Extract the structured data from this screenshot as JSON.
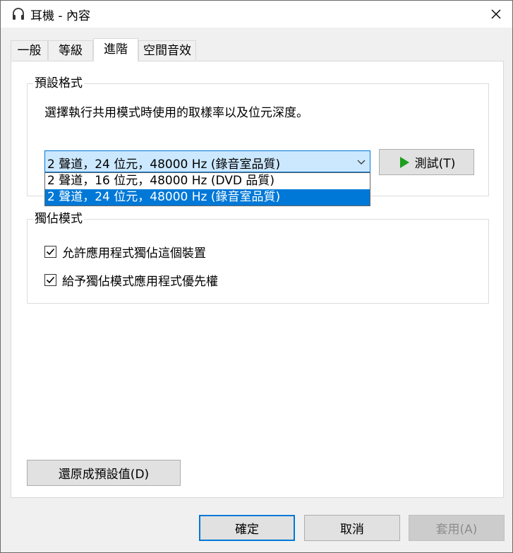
{
  "window": {
    "title": "耳機 - 內容",
    "close_glyph": "✕"
  },
  "tabs": [
    {
      "label": "一般",
      "active": false
    },
    {
      "label": "等級",
      "active": false
    },
    {
      "label": "進階",
      "active": true
    },
    {
      "label": "空間音效",
      "active": false
    }
  ],
  "default_format": {
    "group_label": "預設格式",
    "description": "選擇執行共用模式時使用的取樣率以及位元深度。",
    "selected_value": "2 聲道，24 位元，48000 Hz (錄音室品質)",
    "options": [
      {
        "label": "2 聲道，16 位元，48000 Hz (DVD 品質)",
        "selected": false
      },
      {
        "label": "2 聲道，24 位元，48000 Hz (錄音室品質)",
        "selected": true
      }
    ],
    "test_button_label": "測試(T)"
  },
  "exclusive_mode": {
    "group_label": "獨佔模式",
    "options": [
      {
        "label": "允許應用程式獨佔這個裝置",
        "checked": true
      },
      {
        "label": "給予獨佔模式應用程式優先權",
        "checked": true
      }
    ]
  },
  "restore_defaults_label": "還原成預設值(D)",
  "footer": {
    "ok_label": "確定",
    "cancel_label": "取消",
    "apply_label": "套用(A)",
    "apply_enabled": false
  },
  "colors": {
    "accent": "#0078d7",
    "selection_bg": "#cce8ff",
    "play_green": "#1e9e1e"
  },
  "icons": {
    "window": "headphones-icon",
    "close": "close-icon",
    "dropdown": "chevron-down-icon",
    "test": "play-icon",
    "check": "checkmark-icon"
  }
}
